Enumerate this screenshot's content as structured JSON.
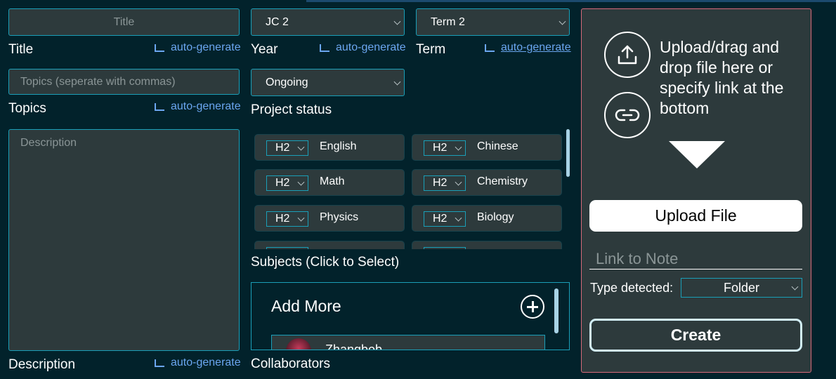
{
  "form": {
    "title": {
      "placeholder": "Title",
      "label": "Title",
      "autogen": "auto-generate"
    },
    "topics": {
      "placeholder": "Topics (seperate with commas)",
      "label": "Topics",
      "autogen": "auto-generate"
    },
    "description": {
      "placeholder": "Description",
      "label": "Description",
      "autogen": "auto-generate"
    },
    "year": {
      "value": "JC 2",
      "label": "Year",
      "autogen": "auto-generate"
    },
    "term": {
      "value": "Term 2",
      "label": "Term",
      "autogen": "auto-generate"
    },
    "status": {
      "value": "Ongoing",
      "label": "Project status"
    }
  },
  "subjects": {
    "label": "Subjects (Click to Select)",
    "items": [
      {
        "level": "H2",
        "name": "English"
      },
      {
        "level": "H2",
        "name": "Chinese"
      },
      {
        "level": "H2",
        "name": "Math"
      },
      {
        "level": "H2",
        "name": "Chemistry"
      },
      {
        "level": "H2",
        "name": "Physics"
      },
      {
        "level": "H2",
        "name": "Biology"
      }
    ]
  },
  "collaborators": {
    "label": "Collaborators",
    "add_more": "Add More",
    "items": [
      {
        "name": "Zhangbob"
      }
    ]
  },
  "upload": {
    "instructions": "Upload/drag and drop file here or specify link at the bottom",
    "upload_button": "Upload File",
    "link_placeholder": "Link to Note",
    "type_label": "Type detected:",
    "type_value": "Folder",
    "create_button": "Create"
  },
  "icons": {
    "upload": "upload-icon",
    "link": "link-icon",
    "add": "plus-circle-icon"
  },
  "colors": {
    "background": "#02222b",
    "field": "#2d3a3c",
    "accent": "#1a9fb8",
    "link": "#6ba6f0",
    "panel_border": "#d96a7a"
  }
}
